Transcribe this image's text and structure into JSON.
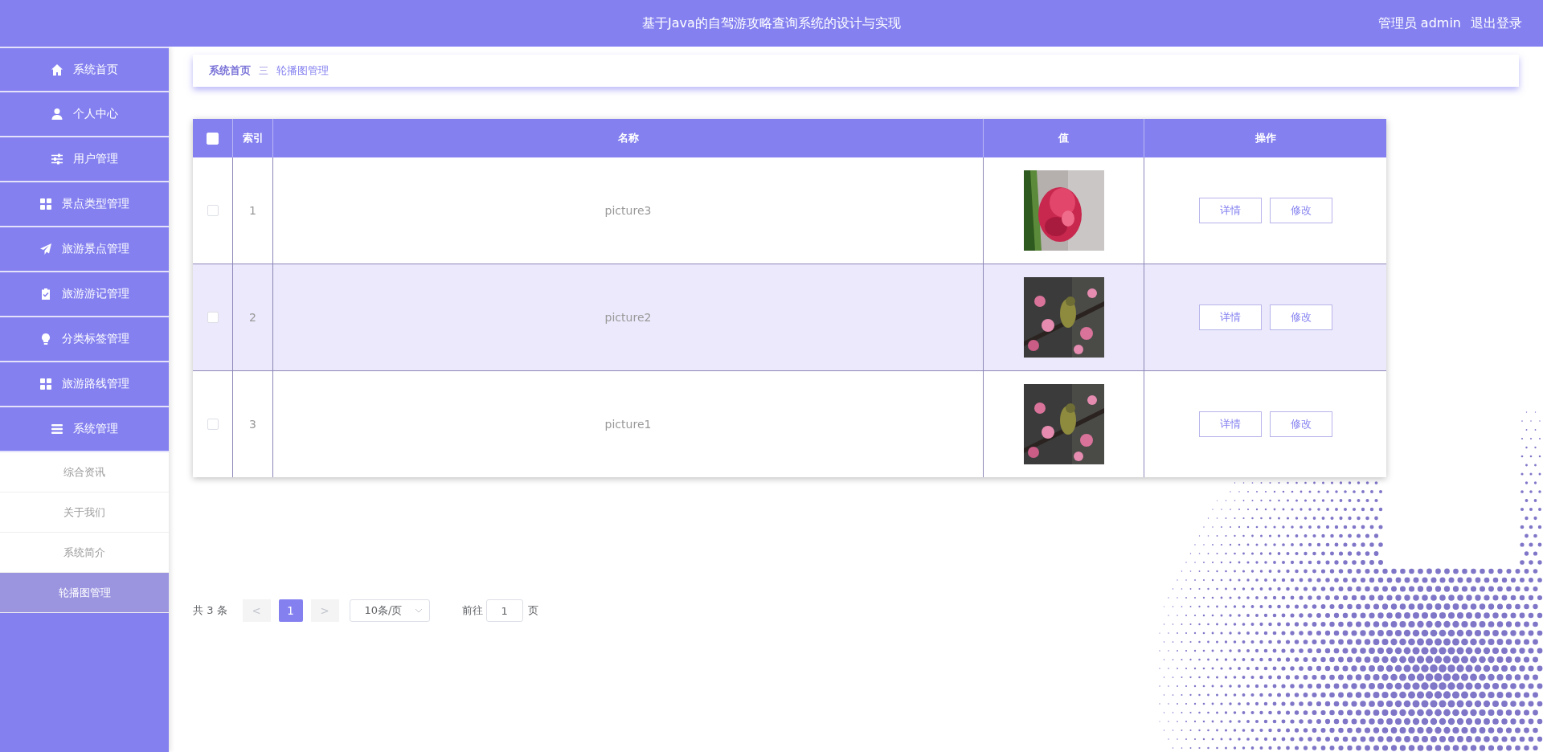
{
  "header": {
    "title": "基于Java的自驾游攻略查询系统的设计与实现",
    "user": "管理员 admin",
    "logout": "退出登录"
  },
  "sidebar": {
    "items": [
      {
        "label": "系统首页"
      },
      {
        "label": "个人中心"
      },
      {
        "label": "用户管理"
      },
      {
        "label": "景点类型管理"
      },
      {
        "label": "旅游景点管理"
      },
      {
        "label": "旅游游记管理"
      },
      {
        "label": "分类标签管理"
      },
      {
        "label": "旅游路线管理"
      },
      {
        "label": "系统管理",
        "children": [
          {
            "label": "综合资讯",
            "selected": false
          },
          {
            "label": "关于我们",
            "selected": false
          },
          {
            "label": "系统简介",
            "selected": false
          },
          {
            "label": "轮播图管理",
            "selected": true
          }
        ]
      }
    ]
  },
  "breadcrumb": {
    "items": [
      "系统首页",
      "轮播图管理"
    ],
    "separator": "三"
  },
  "table": {
    "select_all": {
      "checked": false
    },
    "columns": [
      "索引",
      "名称",
      "值",
      "操作"
    ],
    "rows": [
      {
        "checked": false,
        "hovered": false,
        "index": "1",
        "name": "picture3",
        "value": {
          "kind": "picture"
        },
        "actions": [
          "详情",
          "修改"
        ]
      },
      {
        "checked": false,
        "hovered": true,
        "index": "2",
        "name": "picture2",
        "value": {
          "kind": "picture"
        },
        "actions": [
          "详情",
          "修改"
        ]
      },
      {
        "checked": false,
        "hovered": false,
        "index": "3",
        "name": "picture1",
        "value": {
          "kind": "picture"
        },
        "actions": [
          "详情",
          "修改"
        ]
      }
    ]
  },
  "pagination": {
    "total": "共 3 条",
    "prev": {
      "label": "<",
      "disabled": true
    },
    "pages": [
      {
        "label": "1",
        "selected": true
      }
    ],
    "next": {
      "label": ">",
      "disabled": true
    },
    "page_size": "10条/页",
    "goto_label": "前往",
    "goto_value": "1",
    "goto_suffix": "页"
  }
}
